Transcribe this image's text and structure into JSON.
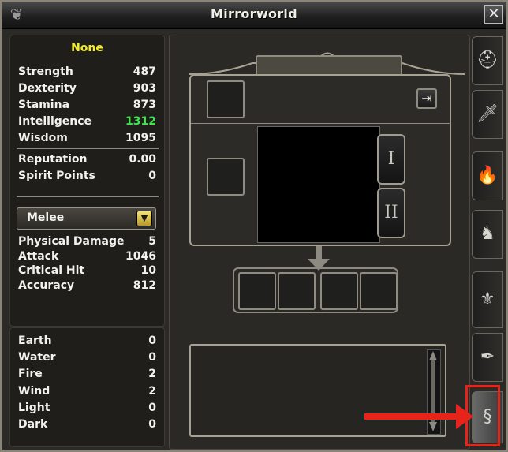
{
  "window": {
    "title": "Mirrorworld",
    "close_icon_char": "✕"
  },
  "stats": {
    "header": "None",
    "attributes": [
      {
        "label": "Strength",
        "value": "487"
      },
      {
        "label": "Dexterity",
        "value": "903"
      },
      {
        "label": "Stamina",
        "value": "873"
      },
      {
        "label": "Intelligence",
        "value": "1312"
      },
      {
        "label": "Wisdom",
        "value": "1095"
      }
    ],
    "misc": [
      {
        "label": "Reputation",
        "value": "0.00"
      },
      {
        "label": "Spirit Points",
        "value": "0"
      }
    ],
    "dropdown": {
      "selected": "Melee",
      "arrow": "▼"
    },
    "combat": [
      {
        "label": "Physical Damage",
        "value": "5"
      },
      {
        "label": "Attack",
        "value": "1046"
      },
      {
        "label": "Critical Hit",
        "value": "10"
      },
      {
        "label": "Accuracy",
        "value": "812"
      }
    ],
    "elements": [
      {
        "label": "Earth",
        "value": "0"
      },
      {
        "label": "Water",
        "value": "0"
      },
      {
        "label": "Fire",
        "value": "2"
      },
      {
        "label": "Wind",
        "value": "2"
      },
      {
        "label": "Light",
        "value": "0"
      },
      {
        "label": "Dark",
        "value": "0"
      }
    ]
  },
  "preview": {
    "tab_one": "I",
    "tab_two": "II",
    "export_icon": "⇥"
  },
  "side_tabs": [
    {
      "name": "helmet-tab",
      "glyph": "⛑"
    },
    {
      "name": "weapon-tab",
      "glyph": "🗡"
    },
    {
      "name": "fire-tab",
      "glyph": "🔥"
    },
    {
      "name": "chess-knight-tab",
      "glyph": "♞"
    },
    {
      "name": "trident-tab",
      "glyph": "⚜"
    },
    {
      "name": "quill-tab",
      "glyph": "✒"
    },
    {
      "name": "mirror-tab",
      "glyph": "§"
    }
  ],
  "colors": {
    "highlight_green": "#3ee84a",
    "header_yellow": "#f5ec2a",
    "annotation_red": "#e8231a"
  }
}
